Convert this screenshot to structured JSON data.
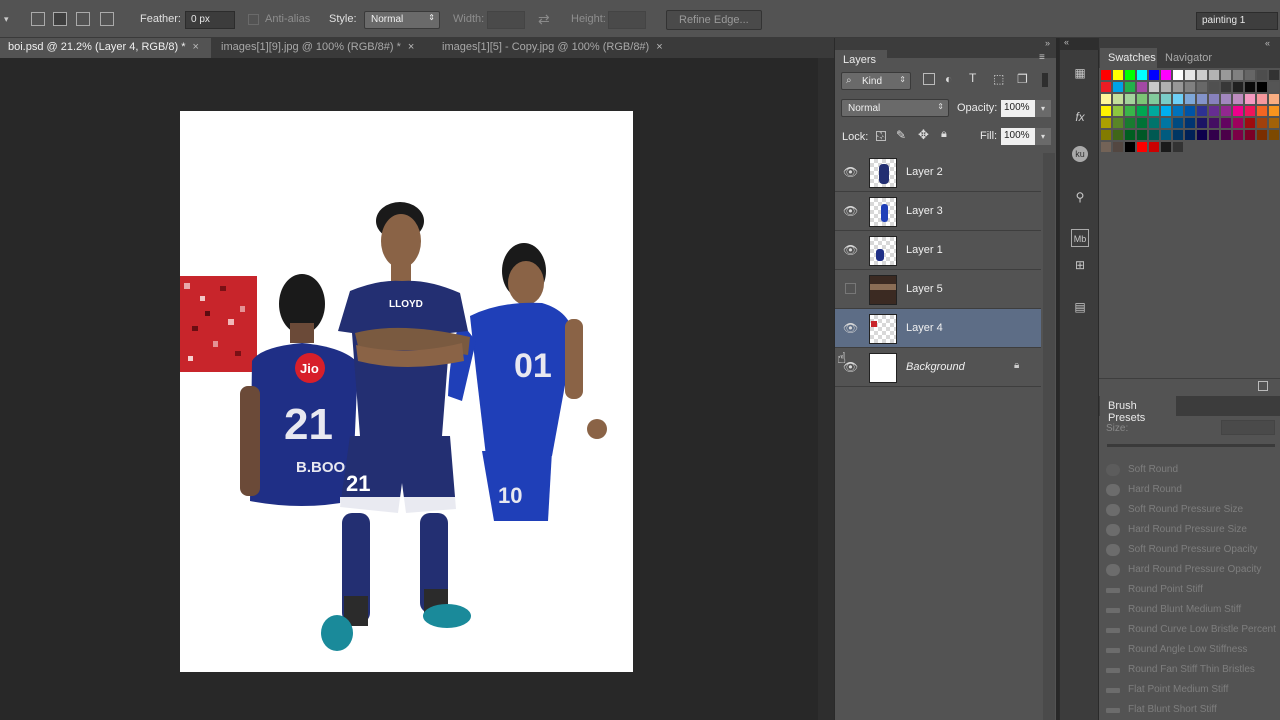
{
  "options_bar": {
    "feather_label": "Feather:",
    "feather_value": "0 px",
    "antialias_label": "Anti-alias",
    "style_label": "Style:",
    "style_value": "Normal",
    "width_label": "Width:",
    "height_label": "Height:",
    "refine_edge": "Refine Edge...",
    "workspace": "painting 1"
  },
  "tabs": [
    {
      "label": "boi.psd @ 21.2% (Layer 4, RGB/8) *"
    },
    {
      "label": "images[1][9].jpg @ 100% (RGB/8#) *"
    },
    {
      "label": "images[1][5] - Copy.jpg @ 100% (RGB/8#)"
    }
  ],
  "canvas": {
    "jersey_left_text": "Jio",
    "jersey_left_number": "21",
    "jersey_left_name": "B.BOOO",
    "jersey_center_text": "LLOYD",
    "jersey_center_number": "21",
    "jersey_right_number": "01",
    "jersey_right_short": "10"
  },
  "layers_panel": {
    "title": "Layers",
    "kind_label": "Kind",
    "blend_mode": "Normal",
    "opacity_label": "Opacity:",
    "opacity_value": "100%",
    "lock_label": "Lock:",
    "fill_label": "Fill:",
    "fill_value": "100%",
    "layers": [
      {
        "name": "Layer 2",
        "visible": true,
        "selected": false
      },
      {
        "name": "Layer 3",
        "visible": true,
        "selected": false
      },
      {
        "name": "Layer 1",
        "visible": true,
        "selected": false
      },
      {
        "name": "Layer 5",
        "visible": false,
        "selected": false
      },
      {
        "name": "Layer 4",
        "visible": true,
        "selected": true
      },
      {
        "name": "Background",
        "visible": true,
        "selected": false,
        "locked": true
      }
    ]
  },
  "strip_icons": [
    "adjustments-icon",
    "fx-icon",
    "ku-icon",
    "clone-icon",
    "mb-icon",
    "measure-icon",
    "notes-icon"
  ],
  "swatches_panel": {
    "tab_swatches": "Swatches",
    "tab_navigator": "Navigator"
  },
  "brush_presets": {
    "title": "Brush Presets",
    "size_label": "Size:",
    "items": [
      "Soft Round",
      "Hard Round",
      "Soft Round Pressure Size",
      "Hard Round Pressure Size",
      "Soft Round Pressure Opacity",
      "Hard Round Pressure Opacity",
      "Round Point Stiff",
      "Round Blunt Medium Stiff",
      "Round Curve Low Bristle Percent",
      "Round Angle Low Stiffness",
      "Round Fan Stiff Thin Bristles",
      "Flat Point Medium Stiff",
      "Flat Blunt Short Stiff"
    ]
  },
  "colors": {
    "panel_bg": "#535353",
    "canvas_bg": "#282828",
    "selection": "#5d6d86",
    "jersey_blue": "#1f2f86"
  }
}
